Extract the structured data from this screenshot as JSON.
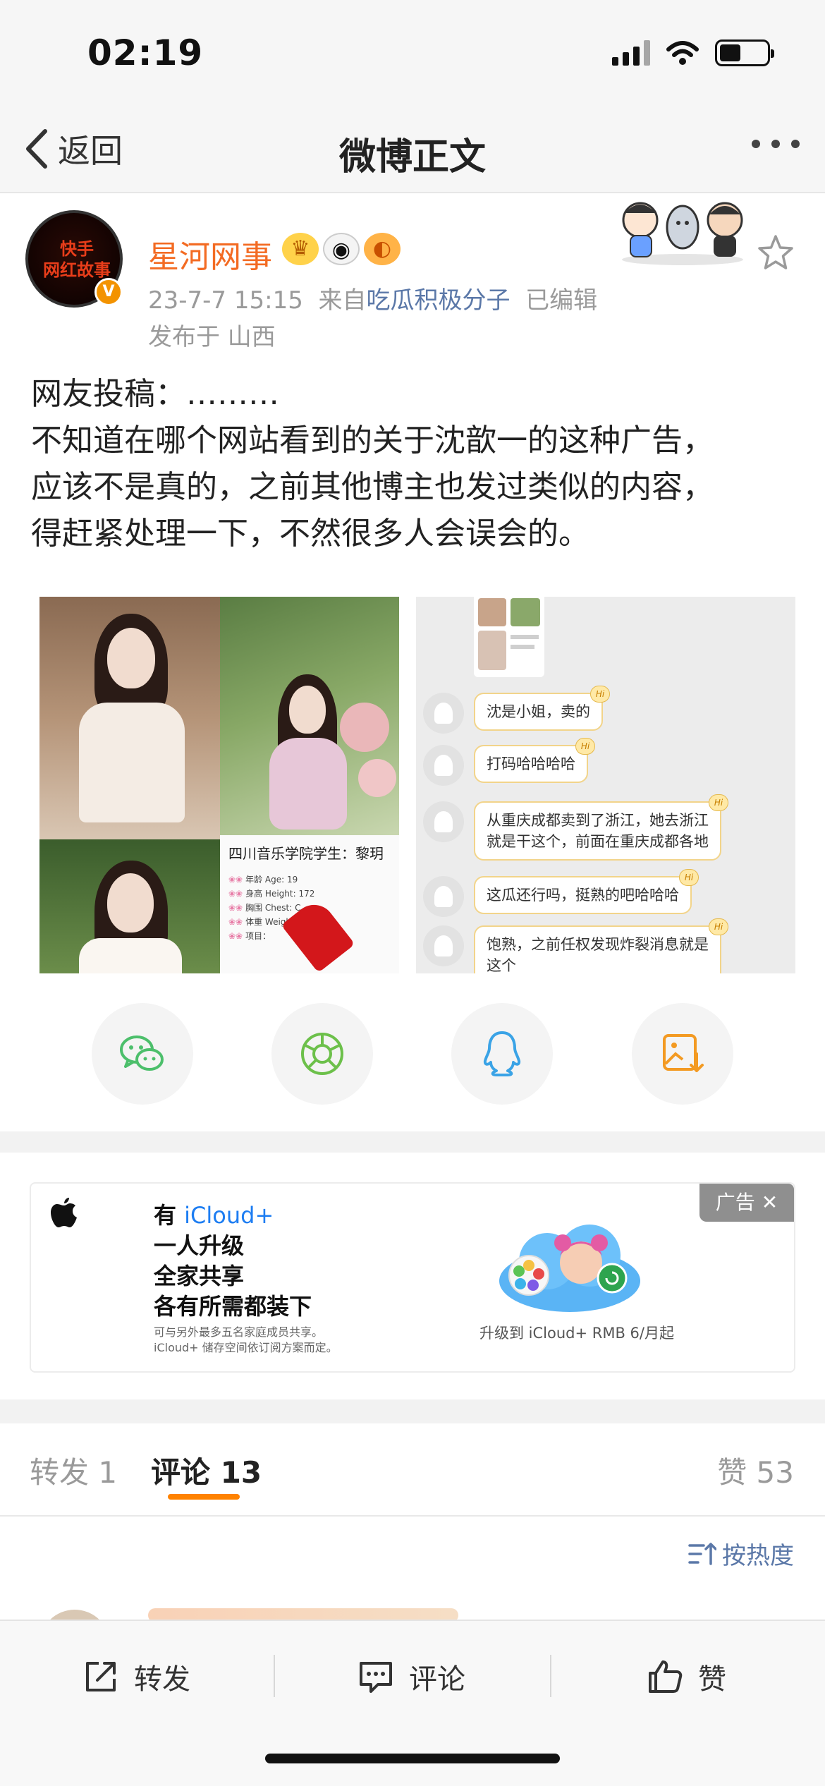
{
  "status_bar": {
    "time": "02:19"
  },
  "nav": {
    "back_label": "返回",
    "title": "微博正文"
  },
  "post": {
    "author": "星河网事",
    "avatar_text": "快手\n网红故事",
    "verified_mark": "V",
    "timestamp": "23-7-7 15:15",
    "source_prefix": "来自",
    "source": "吃瓜积极分子",
    "edited": "已编辑",
    "location": "发布于 山西",
    "text_lines": [
      "网友投稿：………",
      "不知道在哪个网站看到的关于沈歆一的这种广告，",
      "应该不是真的，之前其他博主也发过类似的内容，",
      "得赶紧处理一下，不然很多人会误会的。"
    ]
  },
  "image_left": {
    "profile_title": "四川音乐学院学生：黎玥",
    "lines": [
      "年龄 Age: 19",
      "身高 Height: 172",
      "胸围 Chest: C",
      "体重 Weight: 45kg",
      "项目："
    ]
  },
  "image_right": {
    "hi": "Hi",
    "messages": [
      "沈是小姐，卖的",
      "打码哈哈哈哈",
      "从重庆成都卖到了浙江，她去浙江\n就是干这个，前面在重庆成都各地",
      "这瓜还行吗，挺熟的吧哈哈哈",
      "饱熟，之前任权发现炸裂消息就是\n这个"
    ]
  },
  "share_icons": [
    "wechat-icon",
    "moments-icon",
    "qq-icon",
    "save-image-icon"
  ],
  "ad": {
    "tag": "广告",
    "close": "✕",
    "line1_prefix": "有 ",
    "line1_brand": "iCloud+",
    "line2": "一人升级",
    "line3": "全家共享",
    "line4": "各有所需都装下",
    "small1": "可与另外最多五名家庭成员共享。",
    "small2": "iCloud+ 储存空间依订阅方案而定。",
    "cta": "升级到 iCloud+ RMB 6/月起"
  },
  "tabs": {
    "repost": "转发 1",
    "comment": "评论 13",
    "likes": "赞 53",
    "sort": "按热度"
  },
  "bottom_bar": {
    "repost": "转发",
    "comment": "评论",
    "like": "赞"
  },
  "colors": {
    "accent": "#ff8200",
    "username": "#f36b23",
    "link": "#5b78a8"
  }
}
